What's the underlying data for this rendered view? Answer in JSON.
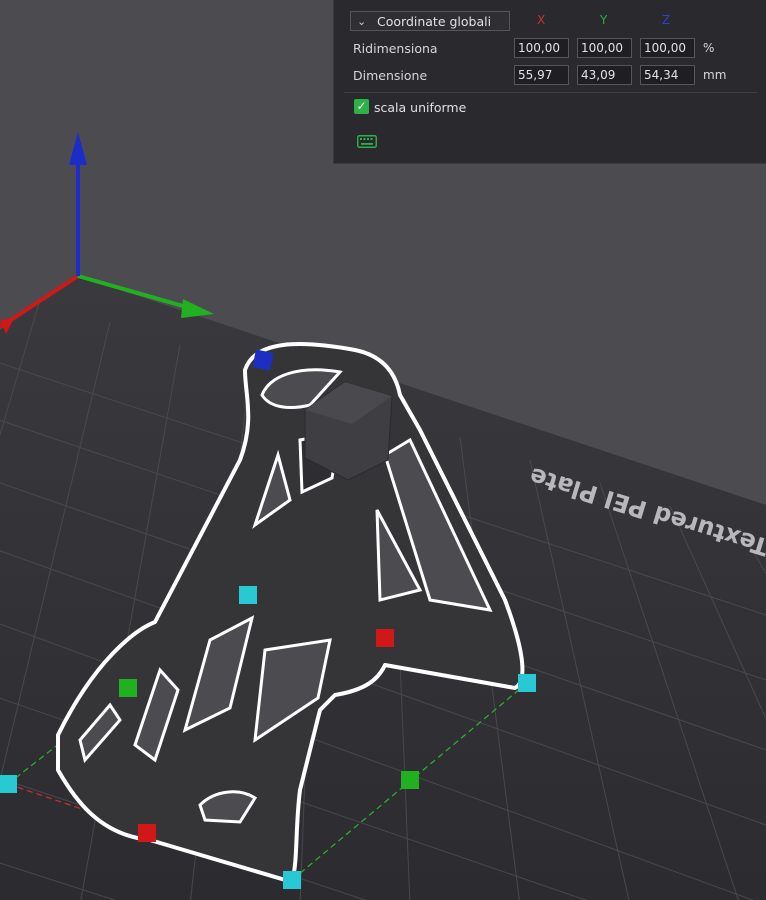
{
  "viewport": {
    "plate_label": "Textured PEI Plate"
  },
  "scale_panel": {
    "coord_system": "Coordinate globali",
    "axis_headers": {
      "x": "X",
      "y": "Y",
      "z": "Z"
    },
    "rows": [
      {
        "label": "Ridimensiona",
        "x": "100,00",
        "y": "100,00",
        "z": "100,00",
        "unit": "%"
      },
      {
        "label": "Dimensione",
        "x": "55,97",
        "y": "43,09",
        "z": "54,34",
        "unit": "mm"
      }
    ],
    "uniform_scale_label": "scala uniforme",
    "uniform_scale_checked": true,
    "keyboard_icon": "keyboard-icon"
  },
  "colors": {
    "axis_x": "#d01818",
    "axis_y": "#20b020",
    "axis_z": "#1c2cc8",
    "handle_corner": "#28c8d4",
    "checkbox": "#2fb14a"
  }
}
